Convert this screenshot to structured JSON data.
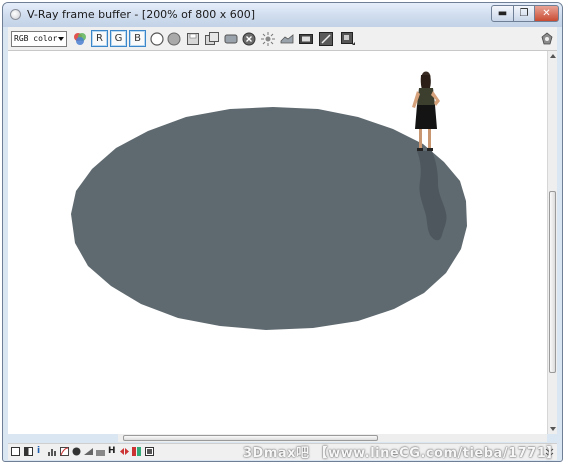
{
  "window": {
    "title": "V-Ray frame buffer - [200% of 800 x 600]",
    "minimize_label": "▬",
    "maximize_label": "❐",
    "close_label": "✕"
  },
  "toolbar": {
    "channel_select_value": "RGB color",
    "buttons": [
      {
        "name": "color-channels-icon"
      },
      {
        "name": "red-channel",
        "label": "R"
      },
      {
        "name": "green-channel",
        "label": "G"
      },
      {
        "name": "blue-channel",
        "label": "B"
      },
      {
        "name": "alpha-channel-icon"
      },
      {
        "name": "monochrome-icon"
      },
      {
        "name": "save-image-icon"
      },
      {
        "name": "save-all-icon"
      },
      {
        "name": "clear-image-icon"
      },
      {
        "name": "stop-render-icon"
      },
      {
        "name": "track-mouse-icon"
      },
      {
        "name": "region-render-icon"
      },
      {
        "name": "duplicate-vfb-icon"
      },
      {
        "name": "render-last-icon"
      },
      {
        "name": "pixel-info-icon"
      },
      {
        "name": "settings-icon"
      }
    ]
  },
  "bottombar": {
    "items": [
      "display-color-correction-icon",
      "lut-icon",
      "info-icon",
      "levels-icon",
      "curve-icon",
      "exposure-icon",
      "srgb-icon",
      "histogram-icon",
      "history-icon",
      "lens-effects-icon",
      "compare-icon"
    ],
    "info_label": "i",
    "history_label": "H"
  },
  "watermark": "3Dmax吧 【www.lineCG.com/tieba/1771】",
  "colors": {
    "accent": "#3a86c8",
    "floor": "#5f6a70",
    "shadow": "#4f5a60",
    "background": "#ffffff"
  }
}
